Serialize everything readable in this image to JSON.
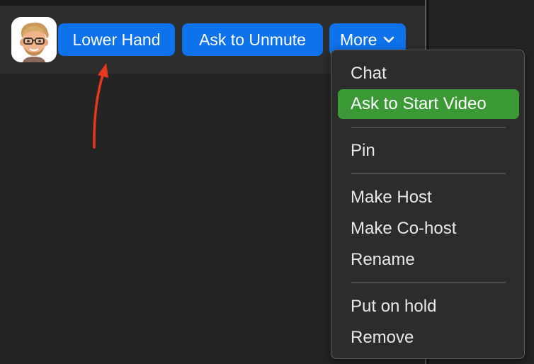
{
  "participant": {
    "avatar_icon": "memoji-avatar-icon",
    "buttons": {
      "lower_hand": "Lower Hand",
      "ask_to_unmute": "Ask to Unmute",
      "more": "More"
    }
  },
  "menu": {
    "items": [
      {
        "label": "Chat"
      },
      {
        "label": "Ask to Start Video"
      },
      {
        "label": "Pin"
      },
      {
        "label": "Make Host"
      },
      {
        "label": "Make Co-host"
      },
      {
        "label": "Rename"
      },
      {
        "label": "Put on hold"
      },
      {
        "label": "Remove"
      }
    ]
  },
  "colors": {
    "button_blue": "#0e72ed",
    "highlight_green": "#3b9a36",
    "annotation_red": "#e8391f",
    "background": "#242424"
  },
  "annotation": {
    "icon": "red-arrow-icon"
  }
}
